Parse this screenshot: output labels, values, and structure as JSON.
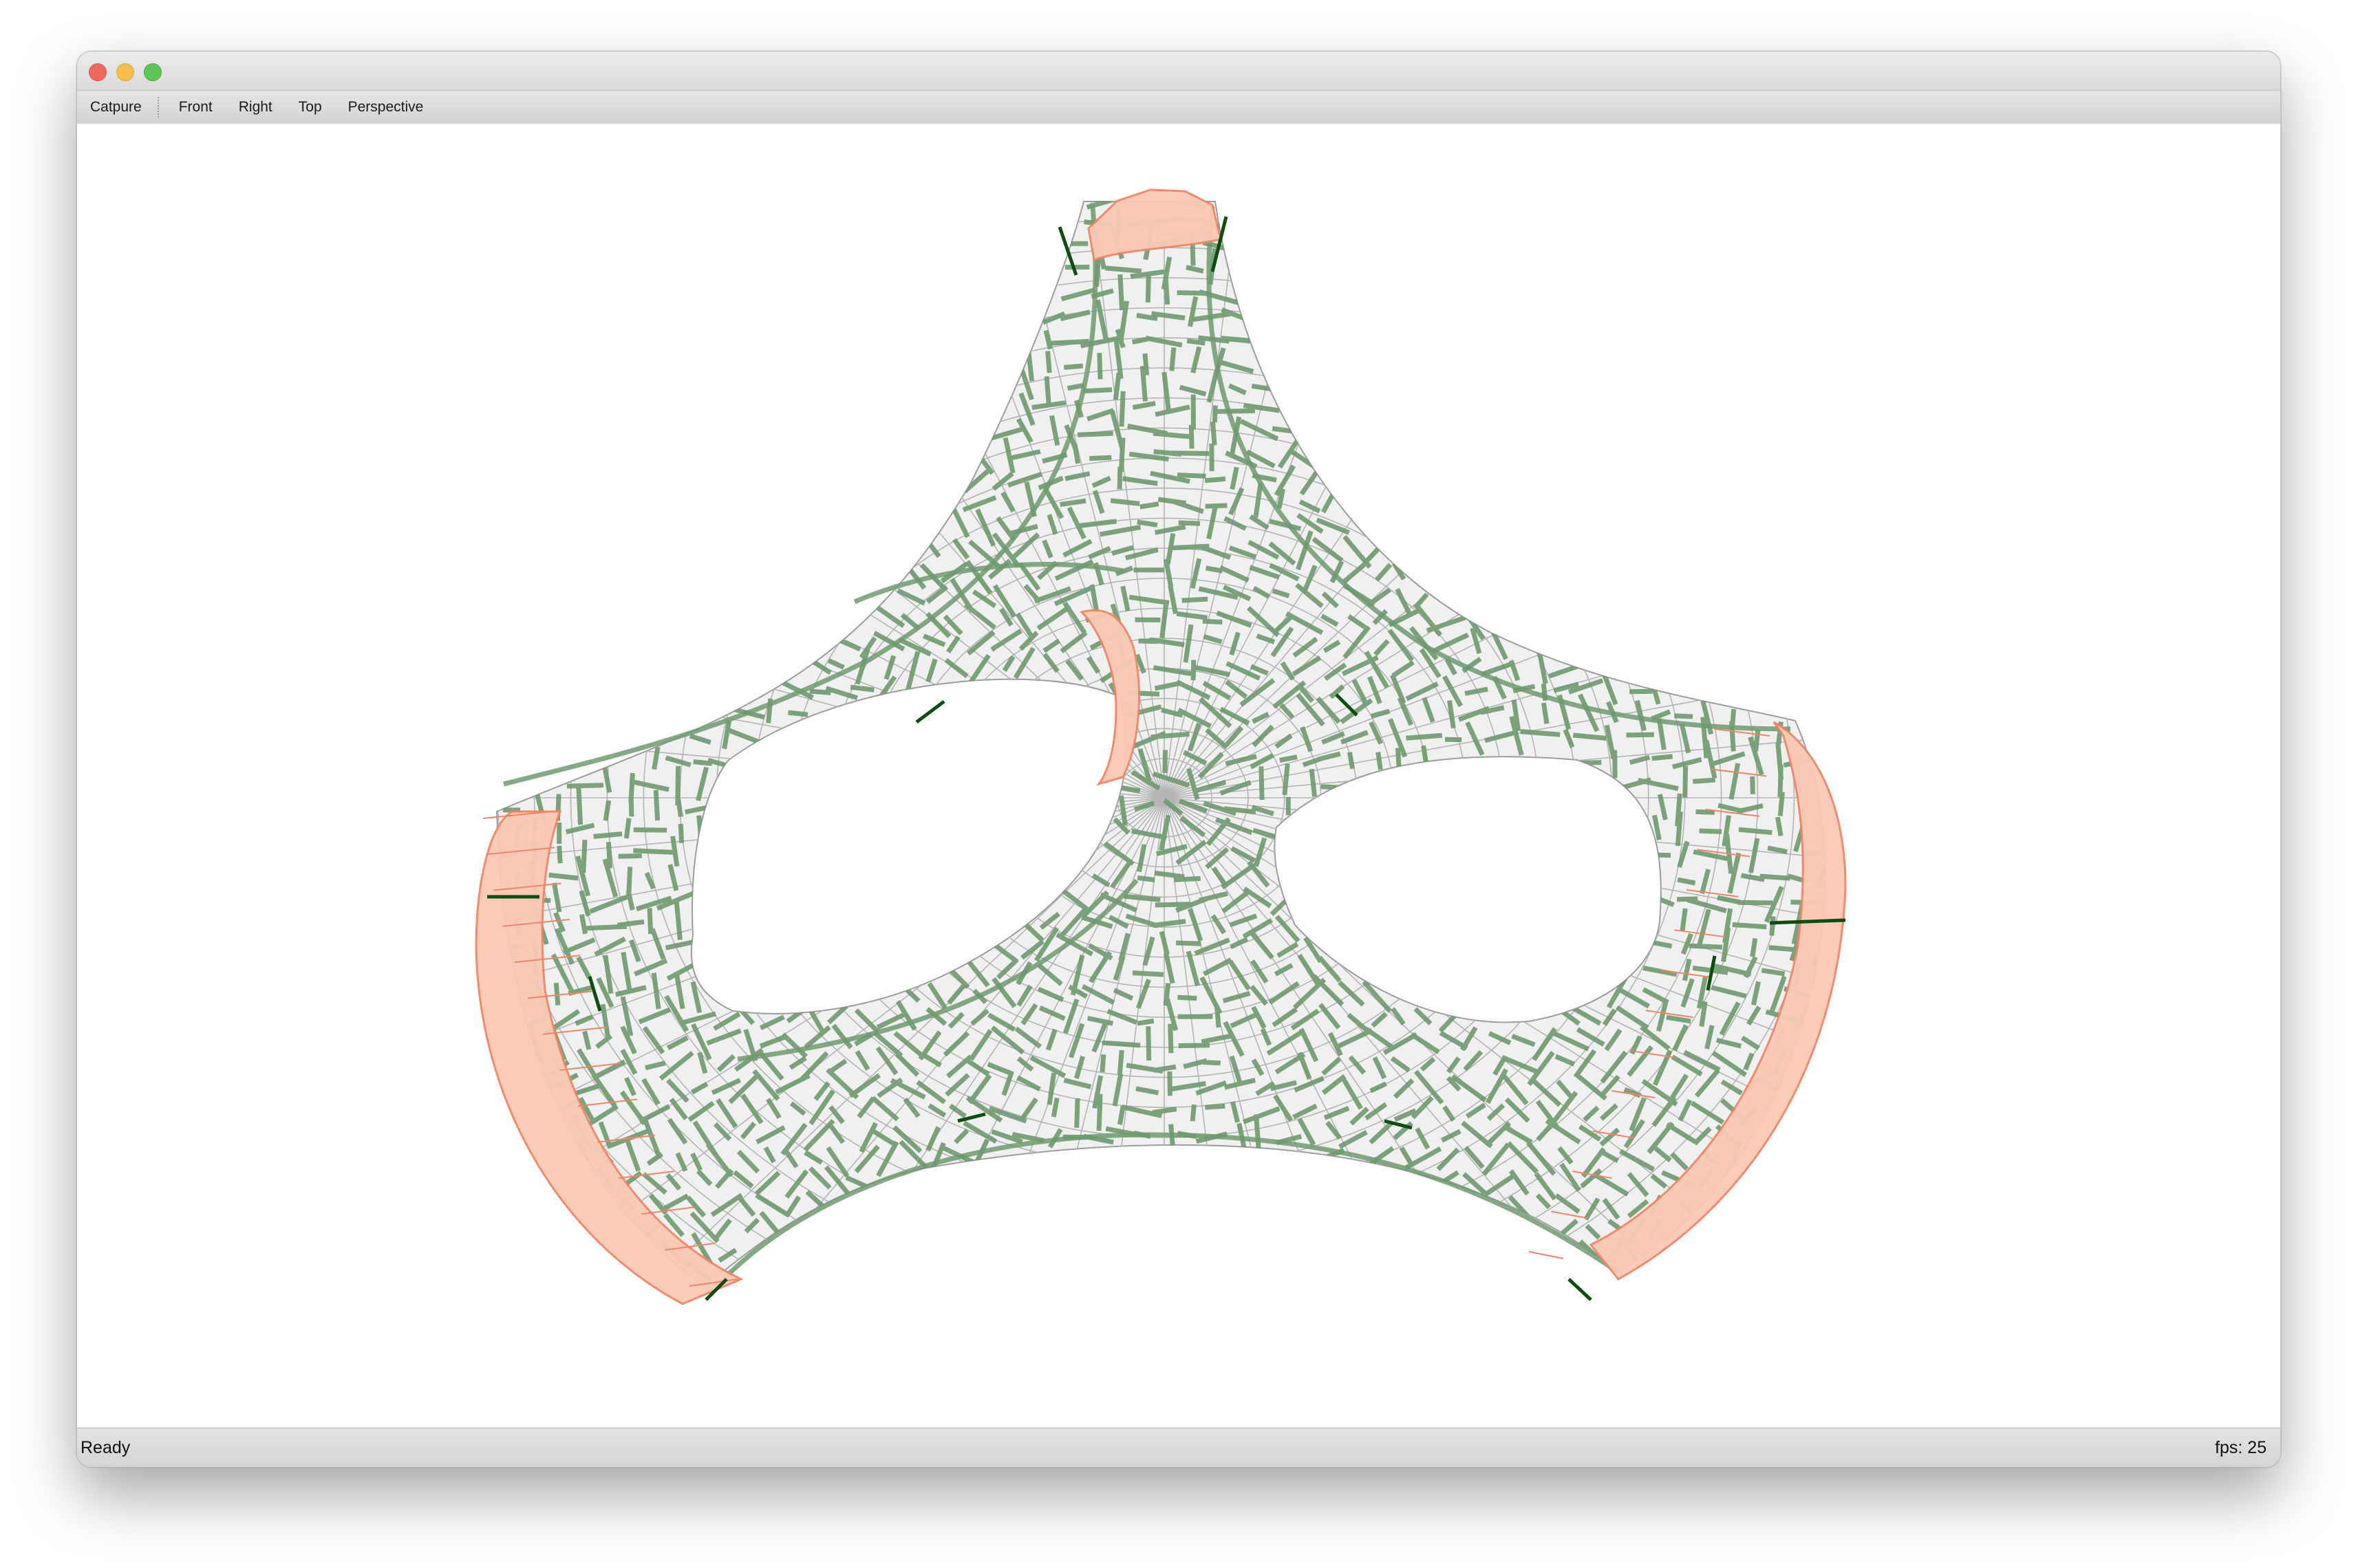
{
  "window": {
    "controls": [
      "close",
      "minimize",
      "zoom"
    ]
  },
  "toolbar": {
    "capture_label": "Catpure",
    "views": [
      "Front",
      "Right",
      "Top",
      "Perspective"
    ]
  },
  "viewport": {
    "content": "3d-mesh-render",
    "colors": {
      "surface": "#f0f0f0",
      "mesh_lines": "#b4b4b4",
      "stress_marks": "#6f9a6f",
      "dark_marks": "#0e4d12",
      "support_fill": "#fbc9b5",
      "support_stroke": "#f08566"
    }
  },
  "status": {
    "left": "Ready",
    "right": "fps: 25"
  }
}
